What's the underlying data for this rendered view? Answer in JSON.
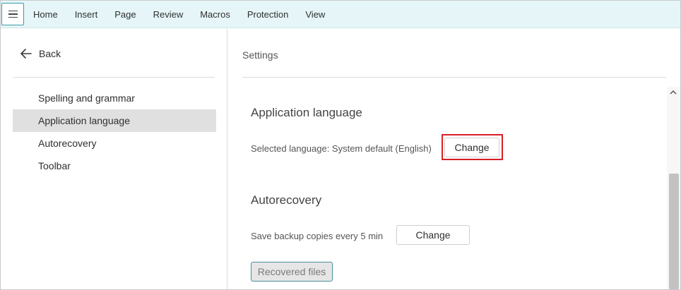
{
  "ribbon": {
    "menu_icon": "hamburger-icon",
    "tabs": [
      "Home",
      "Insert",
      "Page",
      "Review",
      "Macros",
      "Protection",
      "View"
    ]
  },
  "left_panel": {
    "back_label": "Back",
    "back_icon": "arrow-left-icon",
    "items": [
      {
        "label": "Spelling and grammar",
        "active": false
      },
      {
        "label": "Application language",
        "active": true
      },
      {
        "label": "Autorecovery",
        "active": false
      },
      {
        "label": "Toolbar",
        "active": false
      }
    ]
  },
  "main": {
    "title": "Settings",
    "application_language": {
      "heading": "Application language",
      "selected_text": "Selected language: System default (English)",
      "change_label": "Change"
    },
    "autorecovery": {
      "heading": "Autorecovery",
      "backup_text": "Save backup copies every 5 min",
      "change_label": "Change",
      "recovered_label": "Recovered files"
    }
  },
  "colors": {
    "ribbon_bg": "#e6f6f8",
    "accent": "#3a9aa8",
    "highlight": "#d81f26",
    "active_item": "#e0e0e0"
  }
}
